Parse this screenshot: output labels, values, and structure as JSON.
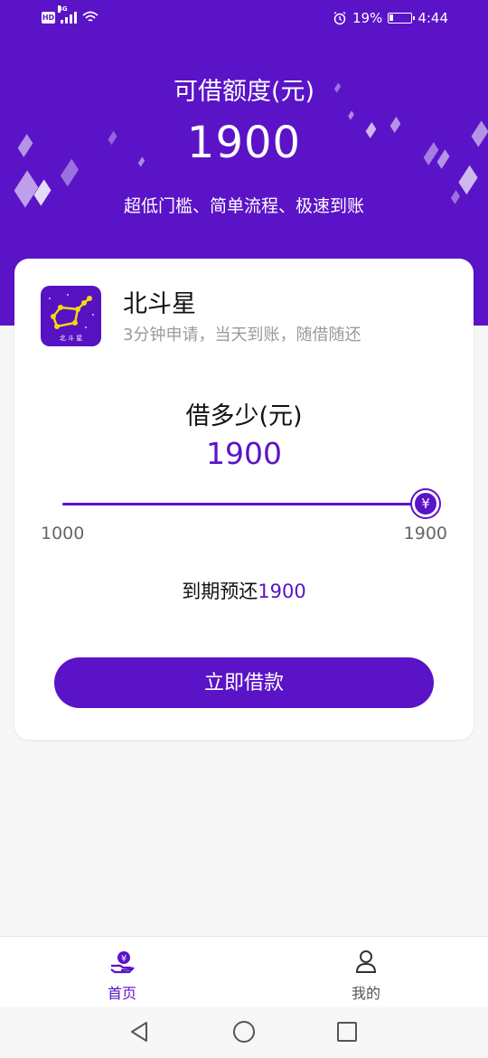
{
  "status_bar": {
    "hd": "HD",
    "network": "4G",
    "battery": "19%",
    "battery_level": 0.19,
    "time": "4:44"
  },
  "header": {
    "title": "可借额度(元)",
    "amount": "1900",
    "subtitle": "超低门槛、简单流程、极速到账"
  },
  "app": {
    "name": "北斗星",
    "description": "3分钟申请，当天到账，随借随还",
    "logo_text": "北 斗 星"
  },
  "loan": {
    "prompt": "借多少(元)",
    "amount": "1900",
    "slider_min": 1000,
    "slider_max": 1900,
    "slider_value": 1900,
    "min_label": "1000",
    "max_label": "1900",
    "thumb_symbol": "¥",
    "repay_label": "到期预还",
    "repay_value": "1900",
    "submit_label": "立即借款"
  },
  "tabs": [
    {
      "label": "首页",
      "icon": "loan-hand-icon",
      "active": true
    },
    {
      "label": "我的",
      "icon": "person-icon",
      "active": false
    }
  ],
  "colors": {
    "accent": "#5b13c8",
    "inactive": "#555555"
  },
  "nav_icons": [
    "back-icon",
    "home-icon",
    "recents-icon"
  ]
}
